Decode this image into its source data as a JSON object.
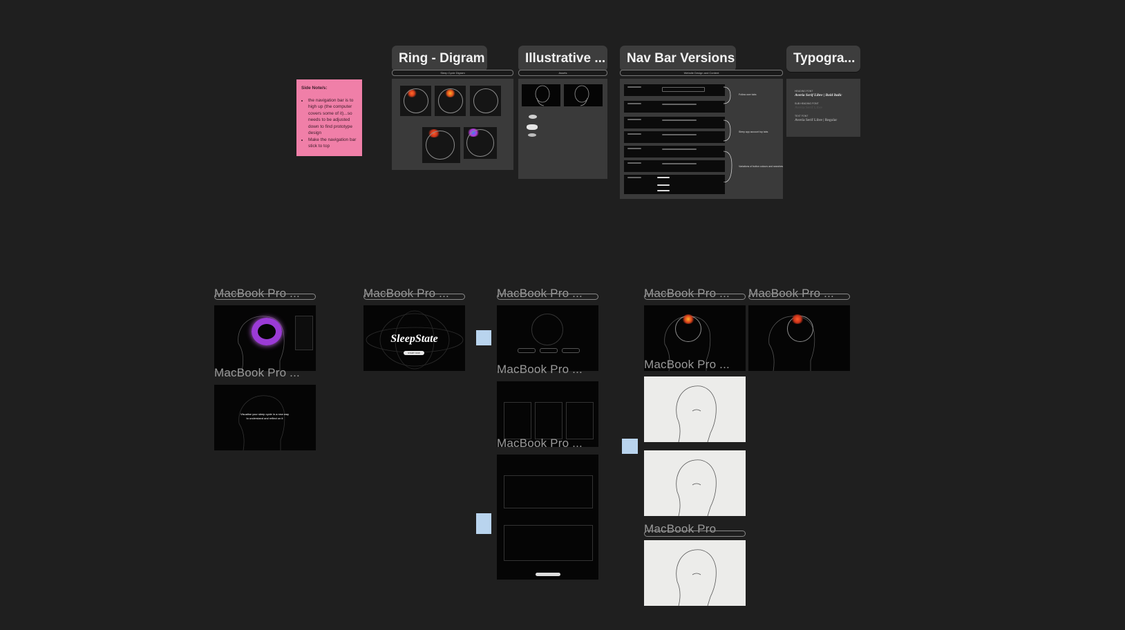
{
  "sections": {
    "ring": {
      "title": "Ring - Digram",
      "subtitle": "Sleep Cycle Digram"
    },
    "illustrative": {
      "title": "Illustrative ...",
      "subtitle": "Assets"
    },
    "nav": {
      "title": "Nav Bar Versions",
      "subtitle": "Website Design and Content"
    },
    "typography": {
      "title": "Typogra...",
      "heading_label": "HEADING FONT",
      "heading_value": "Averia Serif Libre | Bold Italic",
      "subheading_label": "SUB HEADING FONT",
      "subheading_value": "Averia Serif Libre",
      "text_label": "TEXT FONT",
      "text_value": "Averia Serif Libre | Regular"
    }
  },
  "sticky_note": {
    "title": "Side Note/s:",
    "items": [
      "the navigation bar is to high up (the computer covers some of it)...so needs to be adjusted down to find prototype design",
      "Make the navigation bar stick to top"
    ]
  },
  "nav_annotations": [
    "Follow user tabs",
    "Sleep app account top tabs",
    "Variations of button colours and searches"
  ],
  "frames": {
    "label": "MacBook Pro ...",
    "label_plain": "MacBook Pro",
    "sleepstate_title": "SleepState",
    "sleepstate_button": "START NOW",
    "visualise_text_line1": "Visualise your sleep cycle in a new way",
    "visualise_text_line2": "to understand and reflect on it"
  },
  "colors": {
    "canvas": "#1f1f1f",
    "sticky": "#f07fa8",
    "mini_note": "#b9d4ee",
    "frame_dark": "#050505",
    "frame_light": "#ececea",
    "accent_purple": "#9b3bd6",
    "accent_orange": "#e06a2a"
  }
}
